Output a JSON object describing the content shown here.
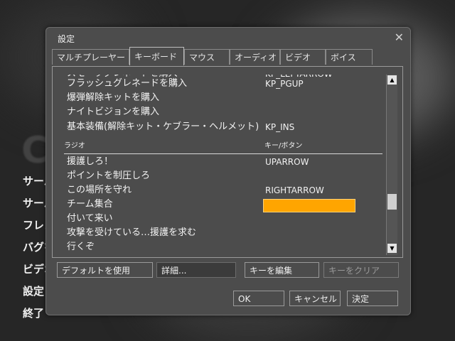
{
  "background": {
    "menu_items": [
      "サーバーを検索",
      "サーバーを作成",
      "フレンド",
      "バグを報告",
      "ビデオ",
      "設定",
      "終了"
    ]
  },
  "dialog": {
    "title": "設定",
    "close_glyph": "✕",
    "tabs": [
      "マルチプレーヤー",
      "キーボード",
      "マウス",
      "オーディオ",
      "ビデオ",
      "ボイス"
    ],
    "active_tab": "キーボード",
    "columns": {
      "action": "ラジオ",
      "key": "キー/ボタン"
    },
    "rows_above": [
      {
        "action": "スモークグレネードを購入",
        "key": "KP_LEFTARROW"
      },
      {
        "action": "フラッシュグレネードを購入",
        "key": "KP_PGUP"
      },
      {
        "action": "爆弾解除キットを購入",
        "key": ""
      },
      {
        "action": "ナイトビジョンを購入",
        "key": ""
      },
      {
        "action": "基本装備(解除キット・ケブラー・ヘルメット)",
        "key": "KP_INS"
      }
    ],
    "radio_rows": [
      {
        "action": "援護しろ！",
        "key": "UPARROW"
      },
      {
        "action": "ポイントを制圧しろ",
        "key": ""
      },
      {
        "action": "この場所を守れ",
        "key": "RIGHTARROW"
      },
      {
        "action": "チーム集合",
        "key": ""
      },
      {
        "action": "付いて来い",
        "key": ""
      },
      {
        "action": "攻撃を受けている…援護を求む",
        "key": ""
      },
      {
        "action": "行くぞ",
        "key": ""
      }
    ],
    "selected_row": "チーム集合",
    "scrollbar": {
      "up": "▲",
      "down": "▼"
    },
    "buttons": {
      "defaults": "デフォルトを使用",
      "advanced": "詳細...",
      "edit_key": "キーを編集",
      "clear_key": "キーをクリア",
      "ok": "OK",
      "cancel": "キャンセル",
      "apply": "決定"
    },
    "colors": {
      "selection": "#ffa500",
      "panel": "#4c4c4c"
    }
  }
}
